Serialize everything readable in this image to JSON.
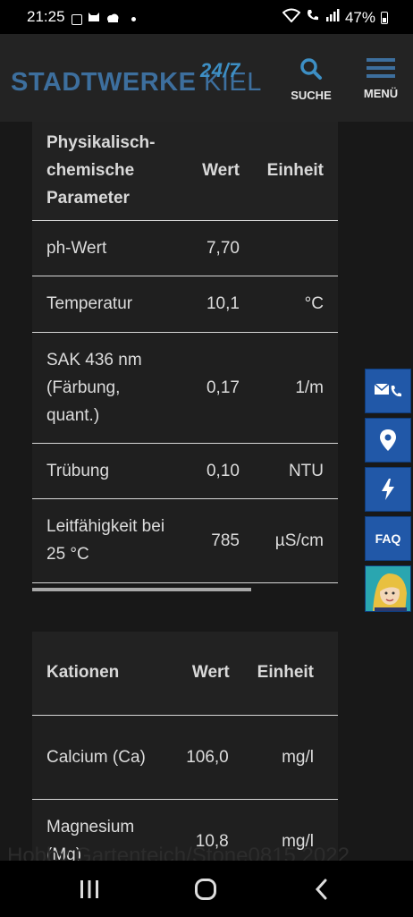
{
  "status_bar": {
    "time": "21:25",
    "battery": "47%"
  },
  "header": {
    "logo": {
      "word1": "STADTWERKE",
      "word2": "KIEL",
      "badge": "24/7"
    },
    "search_label": "SUCHE",
    "menu_label": "MENÜ"
  },
  "table1": {
    "headers": {
      "param": "Physikalisch-chemische Parameter",
      "wert": "Wert",
      "einheit": "Einheit"
    },
    "rows": [
      {
        "param": "ph-Wert",
        "wert": "7,70",
        "einheit": ""
      },
      {
        "param": "Temperatur",
        "wert": "10,1",
        "einheit": "°C"
      },
      {
        "param": "SAK 436 nm (Färbung, quant.)",
        "wert": "0,17",
        "einheit": "1/m"
      },
      {
        "param": "Trübung",
        "wert": "0,10",
        "einheit": "NTU"
      },
      {
        "param": "Leitfähigkeit bei 25 °C",
        "wert": "785",
        "einheit": "µS/cm"
      }
    ]
  },
  "table2": {
    "headers": {
      "param": "Kationen",
      "wert": "Wert",
      "einheit": "Einheit"
    },
    "rows": [
      {
        "param": "Calcium (Ca)",
        "wert": "106,0",
        "einheit": "mg/l"
      },
      {
        "param": "Magnesium (Mg)",
        "wert": "10,8",
        "einheit": "mg/l"
      }
    ]
  },
  "side_rail": {
    "faq_label": "FAQ"
  },
  "watermark": "Hobby Gartenteich/Stone0815 2022",
  "colors": {
    "brand_blue": "#2158a8",
    "logo_blue": "#3d6f9e",
    "icon_blue": "#3d8fc4"
  }
}
